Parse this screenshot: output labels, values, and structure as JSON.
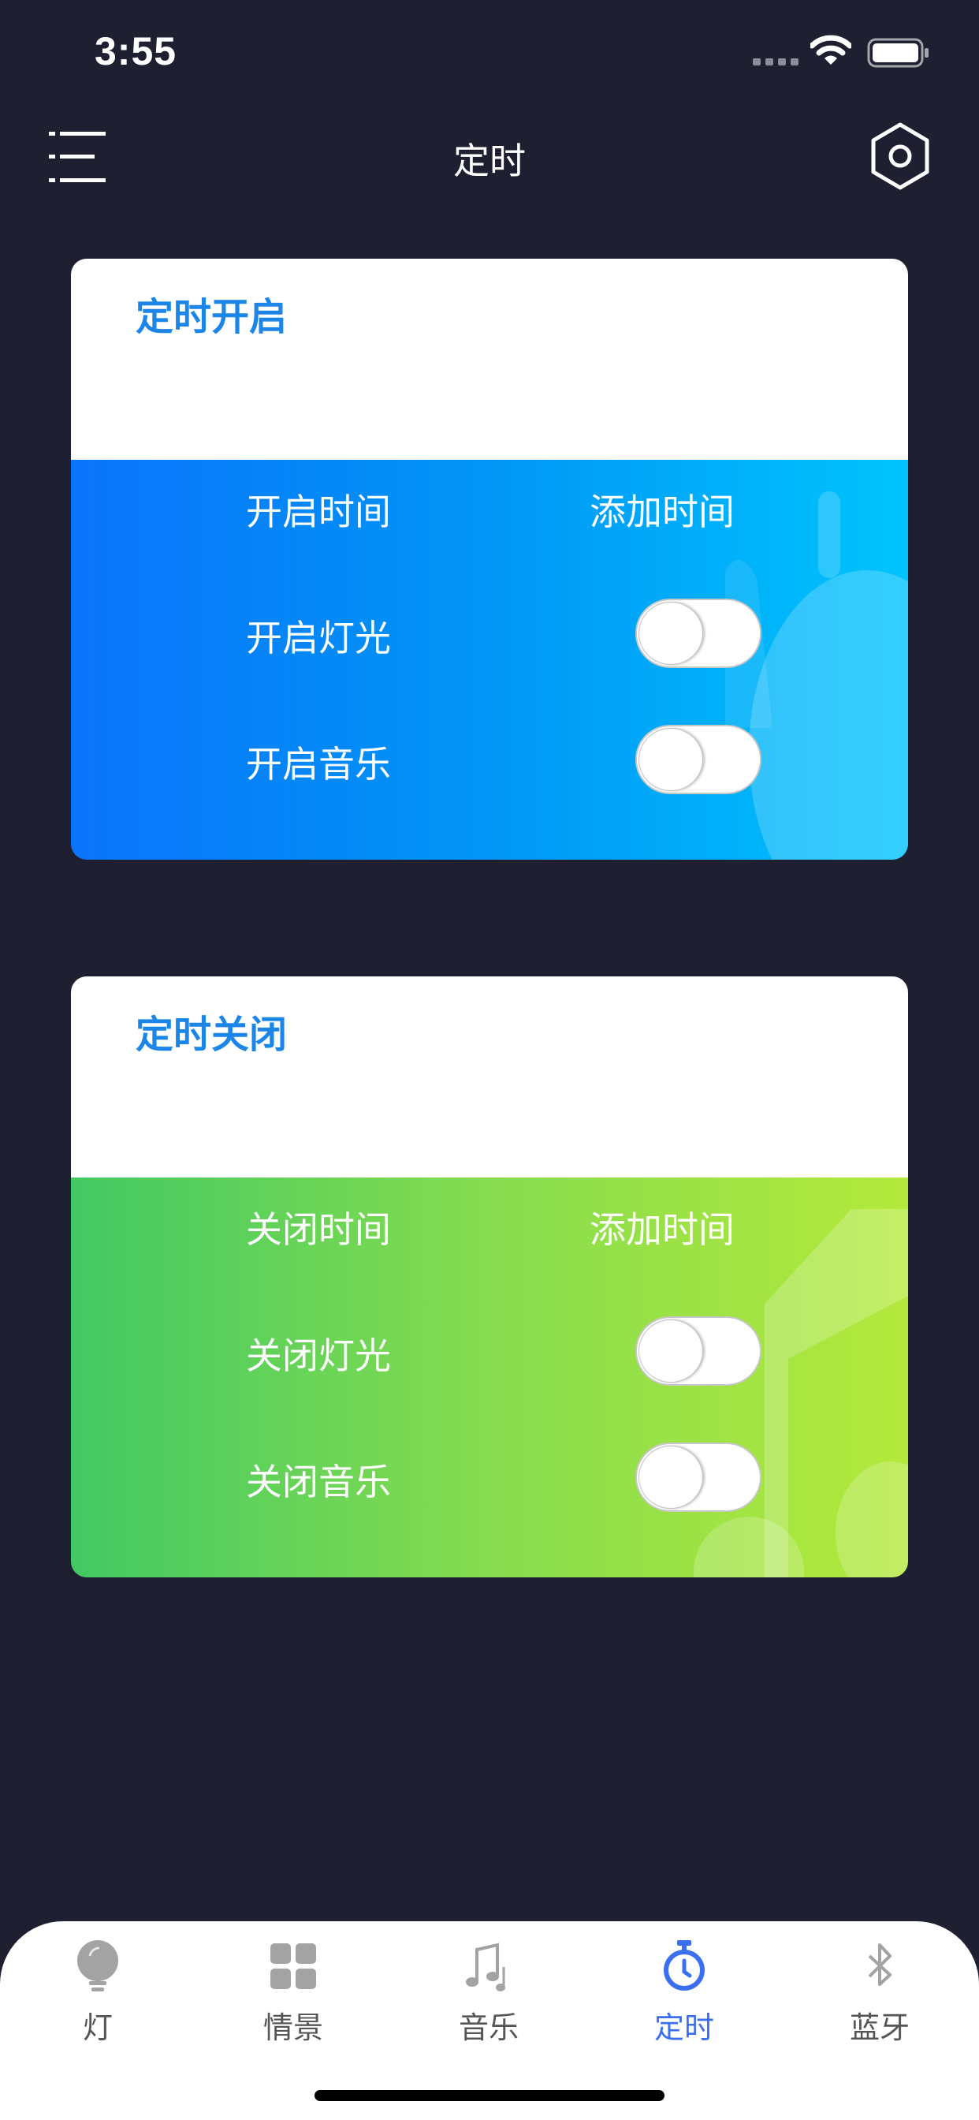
{
  "status_bar": {
    "time": "3:55"
  },
  "nav": {
    "title": "定时"
  },
  "timer_on": {
    "title": "定时开启",
    "time_label": "开启时间",
    "add_time": "添加时间",
    "light_label": "开启灯光",
    "music_label": "开启音乐",
    "light_on": false,
    "music_on": false
  },
  "timer_off": {
    "title": "定时关闭",
    "time_label": "关闭时间",
    "add_time": "添加时间",
    "light_label": "关闭灯光",
    "music_label": "关闭音乐",
    "light_on": false,
    "music_on": false
  },
  "tabs": [
    {
      "label": "灯",
      "icon": "bulb-icon",
      "active": false
    },
    {
      "label": "情景",
      "icon": "grid-icon",
      "active": false
    },
    {
      "label": "音乐",
      "icon": "music-icon",
      "active": false
    },
    {
      "label": "定时",
      "icon": "stopwatch-icon",
      "active": true
    },
    {
      "label": "蓝牙",
      "icon": "bluetooth-icon",
      "active": false
    }
  ],
  "colors": {
    "background": "#1e1f30",
    "title_blue": "#1c86e8",
    "tab_active": "#3b6ef0",
    "on_gradient": [
      "#0a74fb",
      "#00c4fd"
    ],
    "off_gradient": [
      "#42c964",
      "#b4e93b"
    ]
  }
}
